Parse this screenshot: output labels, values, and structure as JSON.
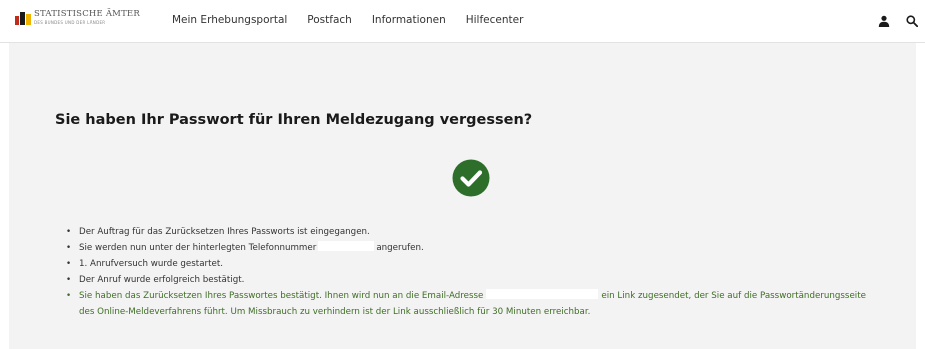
{
  "header": {
    "logo": {
      "title": "STATISTISCHE ÄMTER",
      "subtitle": "DES BUNDES UND DER LÄNDER"
    },
    "nav": [
      {
        "label": "Mein Erhebungsportal"
      },
      {
        "label": "Postfach"
      },
      {
        "label": "Informationen"
      },
      {
        "label": "Hilfecenter"
      }
    ],
    "icons": [
      "user-icon",
      "search-icon"
    ]
  },
  "main": {
    "title": "Sie haben Ihr Passwort für Ihren Meldezugang vergessen?",
    "status_icon": "check-circle-icon",
    "messages": [
      {
        "text": "Der Auftrag für das Zurücksetzen Ihres Passworts ist eingegangen."
      },
      {
        "before": "Sie werden nun unter der hinterlegten Telefonnummer",
        "after": "angerufen."
      },
      {
        "text": "1. Anrufversuch wurde gestartet."
      },
      {
        "text": "Der Anruf wurde erfolgreich bestätigt."
      },
      {
        "before": "Sie haben das Zurücksetzen Ihres Passwortes bestätigt. Ihnen wird nun an die Email-Adresse",
        "after": "ein Link zugesendet, der Sie auf die Passwortänderungsseite des Online-Meldeverfahrens führt. Um Missbrauch zu verhindern ist der Link ausschließlich für 30 Minuten erreichbar."
      }
    ]
  },
  "colors": {
    "success_green": "#2d6e2b",
    "success_text": "#3f6e25",
    "content_background": "#f3f3f3",
    "logo_red": "#c12b1c",
    "logo_gold": "#f0b400"
  }
}
